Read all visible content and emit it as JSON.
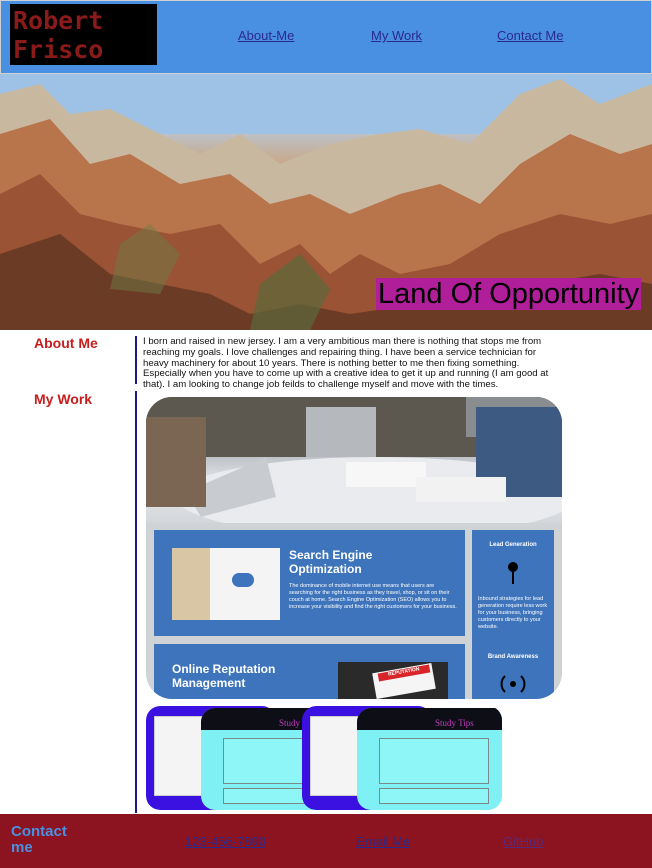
{
  "header": {
    "logo_line1": "Robert",
    "logo_line2": "Frisco",
    "nav": [
      "About-Me",
      "My Work",
      "Contact Me"
    ]
  },
  "hero": {
    "title": "Land Of Opportunity"
  },
  "about": {
    "label": "About Me",
    "text": "I born and raised in new jersey. I am a very ambitious man there is nothing that stops me from reaching my goals. I love challenges and repairing thing. I have been a service technician for heavy machinery for about 10 years. There is nothing better to me then fixing something. Especially when you have to come up with a creative idea to get it up and running (I am good at that). I am looking to change job feilds to challenge myself and move with the times."
  },
  "work": {
    "label": "My Work",
    "card": {
      "seo_title": "Search Engine Optimization",
      "seo_body": "The dominance of mobile internet use means that users are searching for the right business as they travel, shop, or sit on their couch at home. Search Engine Optimization (SEO) allows you to increase your visibility and find the right customers for your business.",
      "lead_title": "Lead Generation",
      "lead_body": "Inbound strategies for lead generation require less work for your business, bringing customers directly to your website.",
      "brand_title": "Brand Awareness",
      "reputation_title": "Online Reputation Management",
      "reputation_badge": "REPUTATION"
    },
    "thumb_title": "Study Tips"
  },
  "footer": {
    "label": "Contact me",
    "phone": "123-456-7890",
    "email": "Email Me",
    "github": "GitHub"
  },
  "colors": {
    "header_bg": "#4a90e2",
    "footer_bg": "#8b1420",
    "accent_red": "#c81d1d",
    "hero_title_bg": "#b01e99"
  }
}
